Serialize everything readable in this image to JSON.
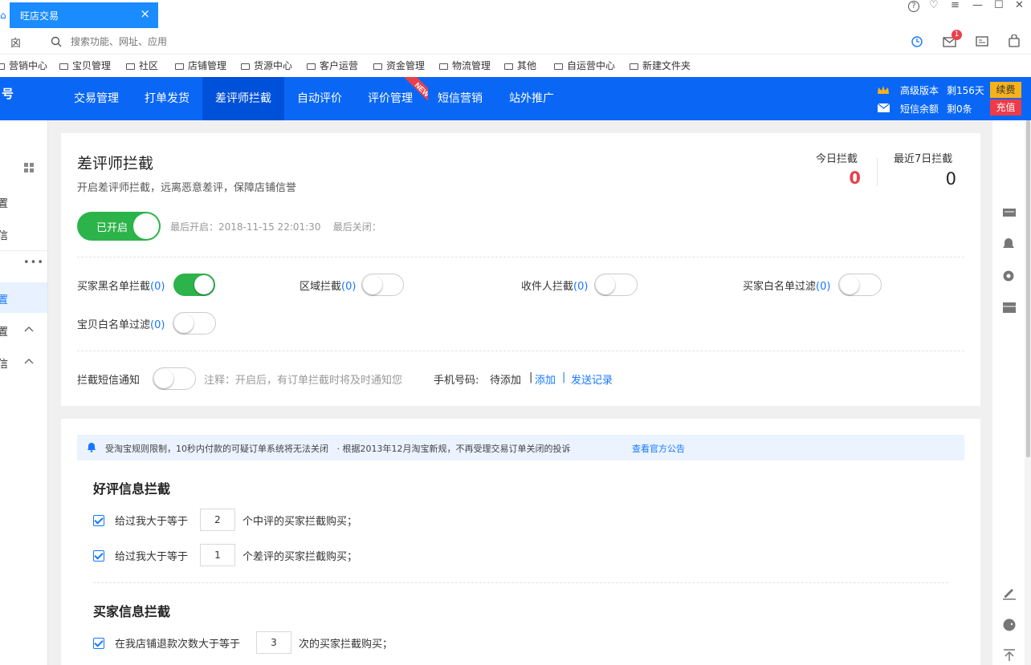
{
  "tab": {
    "title": "旺店交易",
    "close": "×"
  },
  "window": {
    "help": "?",
    "skin": "♡",
    "menu": "≡",
    "minimize": "—",
    "maximize": "☐",
    "close": "✕"
  },
  "address": {
    "nav_glyph": "囟",
    "placeholder": "搜索功能、网址、应用",
    "mail_badge": "1"
  },
  "bookmarks": [
    "营销中心",
    "宝贝管理",
    "社区",
    "店铺管理",
    "货源中心",
    "客户运营",
    "资金管理",
    "物流管理",
    "其他",
    "自运营中心",
    "新建文件夹"
  ],
  "nav": {
    "logo_char": "号",
    "items": [
      "交易管理",
      "打单发货",
      "差评师拦截",
      "自动评价",
      "评价管理",
      "短信营销",
      "站外推广"
    ],
    "active_index": 2,
    "new_tag": "NEW",
    "version_label": "高级版本",
    "version_days": "剩156天",
    "renew": "续费",
    "sms_label": "短信余额",
    "sms_left": "剩0条",
    "recharge": "充值"
  },
  "sidebar": {
    "items": [
      "置",
      "信",
      "置",
      "置",
      "信"
    ]
  },
  "header": {
    "title": "差评师拦截",
    "subtitle": "开启差评师拦截，远离恶意差评，保障店铺信誉",
    "today_label": "今日拦截",
    "today_value": "0",
    "week_label": "最近7日拦截",
    "week_value": "0",
    "master_switch": "已开启",
    "last_info": "最后开启：2018-11-15 22:01:30    最后关闭："
  },
  "options": [
    {
      "label": "买家黑名单拦截",
      "count": "(0)",
      "on": true
    },
    {
      "label": "区域拦截",
      "count": "(0)",
      "on": false
    },
    {
      "label": "收件人拦截",
      "count": "(0)",
      "on": false
    },
    {
      "label": "买家白名单过滤",
      "count": "(0)",
      "on": false
    },
    {
      "label": "宝贝白名单过滤",
      "count": "(0)",
      "on": false
    }
  ],
  "sms": {
    "label": "拦截短信通知",
    "note": "注释：开启后，有订单拦截时将及时通知您",
    "phone_label": "手机号码:",
    "phone_value": "待添加",
    "sep1": "|",
    "add_link": "添加",
    "sep2": "|",
    "record_link": "发送记录"
  },
  "notice": {
    "text": "受淘宝规则限制，10秒内付款的可疑订单系统将无法关闭   · 根据2013年12月淘宝新规，不再受理交易订单关闭的投诉",
    "link": "查看官方公告"
  },
  "good_section": {
    "title": "好评信息拦截",
    "rules": [
      {
        "prefix": "给过我大于等于",
        "value": "2",
        "suffix": "个中评的买家拦截购买；"
      },
      {
        "prefix": "给过我大于等于",
        "value": "1",
        "suffix": "个差评的买家拦截购买；"
      }
    ]
  },
  "buyer_section": {
    "title": "买家信息拦截",
    "rules": [
      {
        "prefix": "在我店铺退款次数大于等于",
        "value": "3",
        "suffix": "次的买家拦截购买；"
      }
    ]
  },
  "colors": {
    "nav": "#0a67f6",
    "nav_active": "#0051d9",
    "accent": "#1677ff",
    "switch_on": "#2cb34a",
    "count_red": "#e8414c",
    "renew": "#f7b21b",
    "recharge": "#ef3b49"
  }
}
